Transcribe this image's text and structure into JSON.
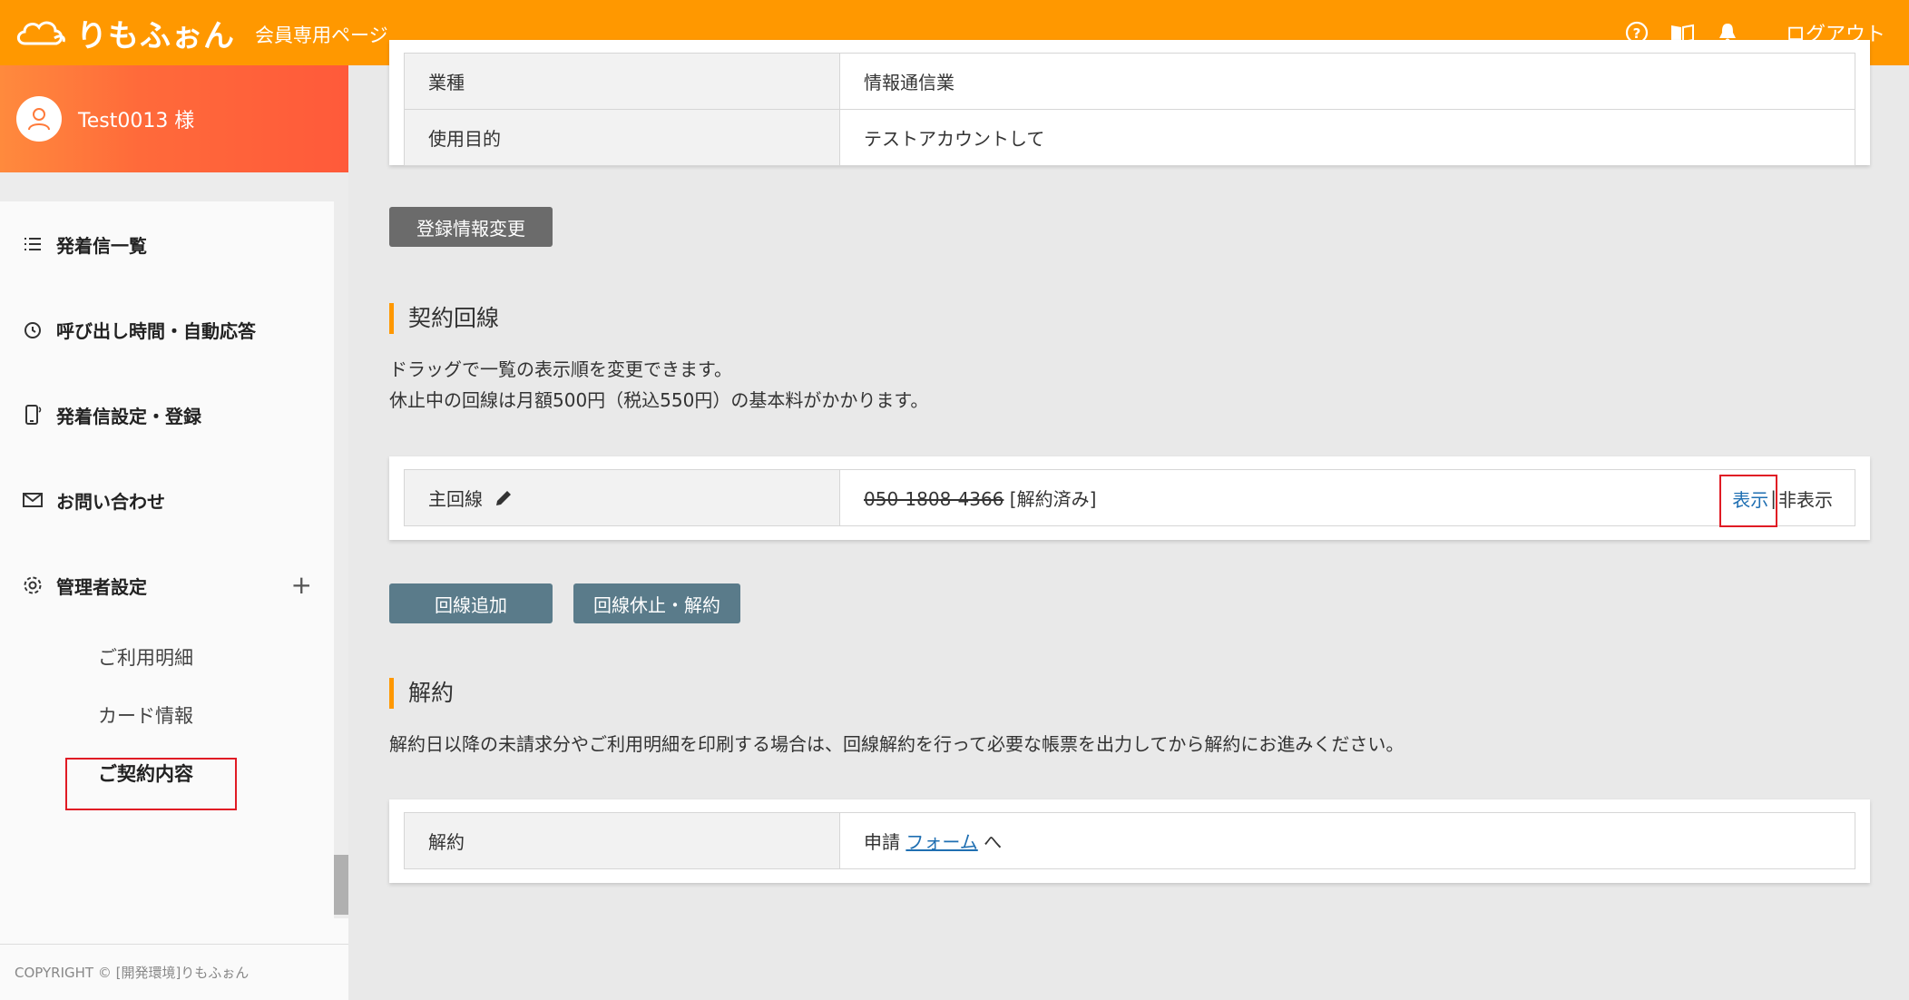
{
  "header": {
    "logo_text": "りもふぉん",
    "subtitle": "会員専用ページ",
    "logout": "ログアウト",
    "icons": [
      "help-circle-icon",
      "book-icon",
      "bell-icon"
    ]
  },
  "sidebar": {
    "username": "Test0013 様",
    "menu": [
      {
        "label": "発着信一覧",
        "icon": "list-icon"
      },
      {
        "label": "呼び出し時間・自動応答",
        "icon": "clock-icon"
      },
      {
        "label": "発着信設定・登録",
        "icon": "phone-icon"
      },
      {
        "label": "お問い合わせ",
        "icon": "mail-icon"
      },
      {
        "label": "管理者設定",
        "icon": "gear-icon",
        "expand": "+"
      }
    ],
    "submenu": [
      {
        "label": "ご利用明細"
      },
      {
        "label": "カード情報"
      },
      {
        "label": "ご契約内容"
      }
    ],
    "copyright": "COPYRIGHT © [開発環境]りもふぉん"
  },
  "top_table": {
    "rows": [
      {
        "key": "業種",
        "value": "情報通信業"
      },
      {
        "key": "使用目的",
        "value": "テストアカウントして"
      }
    ]
  },
  "edit_button": "登録情報変更",
  "lines_section": {
    "title": "契約回線",
    "desc1": "ドラッグで一覧の表示順を変更できます。",
    "desc2": "休止中の回線は月額500円（税込550円）の基本料がかかります。",
    "row": {
      "key": "主回線",
      "number": "050-1808-4366",
      "status": " [解約済み]",
      "show": "表示",
      "separator": "|",
      "hide": "非表示"
    },
    "add_button": "回線追加",
    "suspend_button": "回線休止・解約"
  },
  "cancel_section": {
    "title": "解約",
    "desc": "解約日以降の未請求分やご利用明細を印刷する場合は、回線解約を行って必要な帳票を出力してから解約にお進みください。",
    "row": {
      "key": "解約",
      "prefix": "申請 ",
      "link": "フォーム",
      "suffix": " へ"
    }
  },
  "colors": {
    "header": "#ff9800",
    "accent": "#ff9800",
    "highlight_box": "#e01b24",
    "link": "#1f6fb2",
    "button_gray": "#6b6b6b",
    "button_slate": "#5a7b8a"
  }
}
